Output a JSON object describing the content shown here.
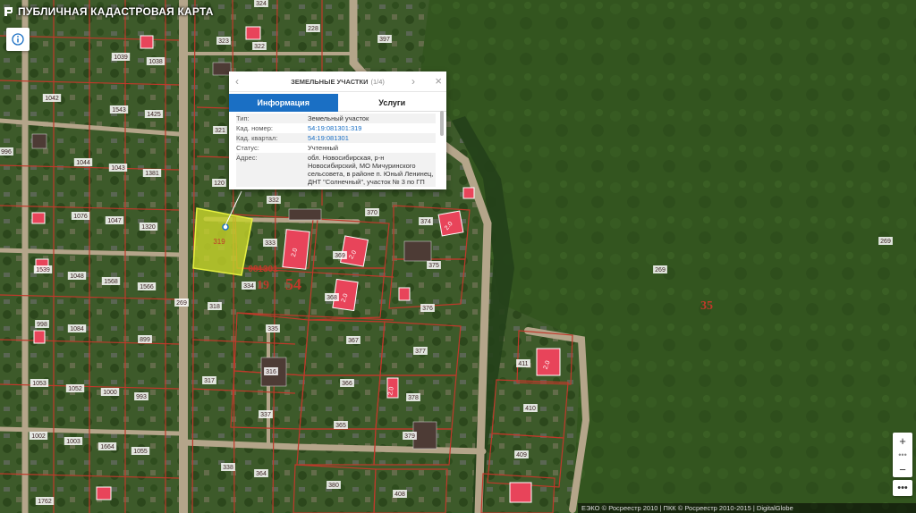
{
  "app": {
    "title": "ПУБЛИЧНАЯ КАДАСТРОВАЯ КАРТА"
  },
  "popup": {
    "title": "ЗЕМЕЛЬНЫЕ УЧАСТКИ",
    "counter": "(1/4)",
    "tabs": [
      "Информация",
      "Услуги"
    ],
    "rows": [
      {
        "key": "Тип:",
        "value": "Земельный участок"
      },
      {
        "key": "Кад. номер:",
        "value": "54:19:081301:319"
      },
      {
        "key": "Кад. квартал:",
        "value": "54:19:081301"
      },
      {
        "key": "Статус:",
        "value": "Учтенный"
      },
      {
        "key": "Адрес:",
        "value": "обл. Новосибирская, р-н Новосибирский, МО Мичуринского сельсовета, в районе п. Юный Ленинец, ДНТ \"Солнечный\", участок № 3 по ГП"
      }
    ]
  },
  "attribution": "ЕЭКО © Росреестр 2010 | ПКК © Росреестр 2010-2015 | DigitalGlobe",
  "map": {
    "selected_parcel": "319",
    "quarter_label": "081301",
    "region_code": "19",
    "district_code": "54",
    "field_code": "35",
    "parcel_labels": [
      "324",
      "228",
      "397",
      "323",
      "322",
      "1039",
      "1038",
      "1042",
      "1543",
      "1425",
      "996",
      "1044",
      "1043",
      "1381",
      "321",
      "120",
      "332",
      "1076",
      "1047",
      "1320",
      "370",
      "374",
      "333",
      "1539",
      "1048",
      "1568",
      "1566",
      "369",
      "375",
      "334",
      "368",
      "318",
      "269",
      "998",
      "1084",
      "899",
      "335",
      "367",
      "376",
      "377",
      "1053",
      "1052",
      "1000",
      "993",
      "317",
      "316",
      "366",
      "378",
      "411",
      "1002",
      "1003",
      "1664",
      "1055",
      "337",
      "365",
      "379",
      "410",
      "409",
      "1762",
      "338",
      "364",
      "380",
      "408",
      "330",
      "997",
      "346",
      "1046",
      "1423"
    ],
    "parcel_labels_placed": [
      "324",
      "228",
      "397",
      "323",
      "322",
      "1039",
      "1038",
      "1042",
      "1543",
      "1425",
      "996",
      "1044",
      "1043",
      "1381",
      "321",
      "120",
      "332",
      "1076",
      "1047",
      "1320",
      "370",
      "374",
      "333",
      "1539",
      "1048",
      "1568",
      "1566",
      "369",
      "375",
      "334",
      "368",
      "318",
      "269",
      "269",
      "269",
      "998",
      "1084",
      "899",
      "335",
      "367",
      "376",
      "377",
      "1053",
      "1052",
      "1000",
      "993",
      "317",
      "316",
      "366",
      "378",
      "411",
      "1002",
      "1003",
      "1664",
      "1055",
      "337",
      "365",
      "379",
      "410",
      "409",
      "1762",
      "338",
      "364",
      "380",
      "408"
    ],
    "building_labels": [
      "2.0",
      "2.0",
      "2.0",
      "2.0",
      "2.0",
      "2.0"
    ]
  },
  "colors": {
    "accent": "#1a6fc4",
    "parcel_border": "#c0392b",
    "selected_fill": "#c8d42a"
  },
  "icons": [
    "logo-icon",
    "info-icon",
    "chevron-left-icon",
    "chevron-right-icon",
    "close-icon",
    "zoom-in-icon",
    "zoom-out-icon",
    "more-icon"
  ]
}
